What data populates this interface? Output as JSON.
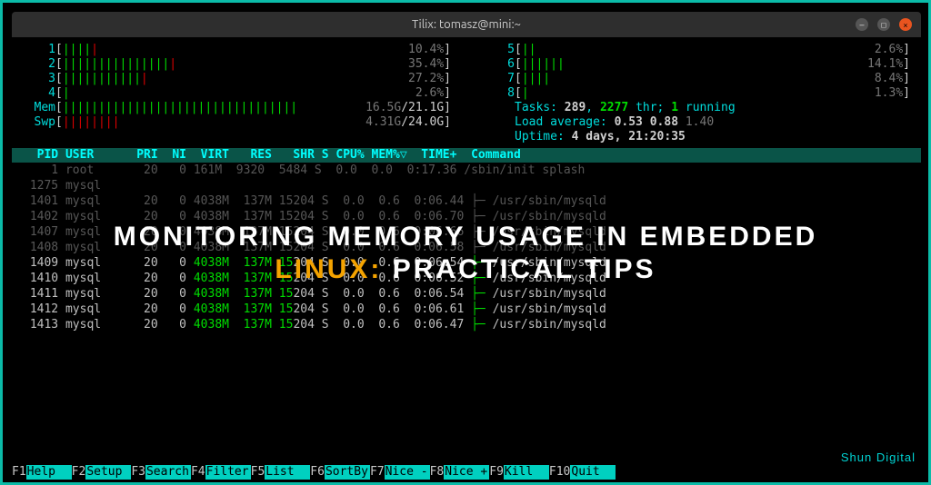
{
  "titlebar": {
    "title": "Tilix: tomasz@mini:~"
  },
  "overlay": {
    "line1": "MONITORING MEMORY USAGE IN EMBEDDED",
    "line2a": "LINUX:",
    "line2b": " PRACTICAL TIPS"
  },
  "brand": "Shun Digital",
  "cpus_left": [
    {
      "n": "1",
      "bars": "||||",
      "red": "|",
      "val": "10.4%"
    },
    {
      "n": "2",
      "bars": "|||||||||||||||",
      "red": "|",
      "val": "35.4%"
    },
    {
      "n": "3",
      "bars": "|||||||||||",
      "red": "|",
      "val": "27.2%"
    },
    {
      "n": "4",
      "bars": "|",
      "red": "",
      "val": "2.6%"
    }
  ],
  "cpus_right": [
    {
      "n": "5",
      "bars": "||",
      "red": "",
      "val": "2.6%"
    },
    {
      "n": "6",
      "bars": "||||||",
      "red": "",
      "val": "14.1%"
    },
    {
      "n": "7",
      "bars": "||||",
      "red": "",
      "val": "8.4%"
    },
    {
      "n": "8",
      "bars": "|",
      "red": "",
      "val": "1.3%"
    }
  ],
  "mem": {
    "label": "Mem",
    "green": "|||||||||||||||||||||||||||||||||",
    "used": "16.5G",
    "total": "21.1G"
  },
  "swp": {
    "label": "Swp",
    "red": "||||||||",
    "used": "4.31G",
    "total": "24.0G"
  },
  "sys": {
    "tasks_lbl": "Tasks: ",
    "tasks_n": "289",
    "thr_sep": ", ",
    "thr_n": "2277",
    "thr_lbl": " thr; ",
    "run_n": "1",
    "run_lbl": " running",
    "load_lbl": "Load average: ",
    "l1": "0.53",
    "l2": "0.88",
    "l3": "1.40",
    "uptime_lbl": "Uptime: ",
    "uptime": "4 days, 21:20:35"
  },
  "header": "  PID USER      PRI  NI  VIRT   RES   SHR S CPU% MEM%▽  TIME+  Command",
  "rows": [
    {
      "dim": true,
      "pre": "    1 root       20   0 ",
      "virt": "161M",
      "mid": "  9320  ",
      "shr": "5484",
      "post": " S  0.0  0.0  0:17.36 ",
      "cmd": "/sbin/init splash"
    },
    {
      "dim": true,
      "pre": " 1275 mysql",
      "virt": "",
      "mid": "",
      "shr": "",
      "post": "",
      "cmd": ""
    },
    {
      "dim": true,
      "pre": " 1401 mysql      20   0 ",
      "virt": "4038M",
      "mid": "  ",
      "res": "137M",
      "mid2": " ",
      "shr": "15204",
      "post": " S  0.0  0.6  0:06.44 ",
      "tree": "├─ ",
      "cmd": "/usr/sbin/mysqld"
    },
    {
      "dim": true,
      "pre": " 1402 mysql      20   0 ",
      "virt": "4038M",
      "mid": "  ",
      "res": "137M",
      "mid2": " ",
      "shr": "15204",
      "post": " S  0.0  0.6  0:06.70 ",
      "tree": "├─ ",
      "cmd": "/usr/sbin/mysqld"
    },
    {
      "dim": true,
      "pre": " 1407 mysql      20   0 ",
      "virt": "4038M",
      "mid": "  ",
      "res": "137M",
      "mid2": " ",
      "shr": "15204",
      "post": " S  0.0  0.6  0:06.66 ",
      "tree": "├─ ",
      "cmd": "/usr/sbin/mysqld"
    },
    {
      "dim": true,
      "pre": " 1408 mysql      20   0 ",
      "virt": "4038M",
      "mid": "  ",
      "res": "137M",
      "mid2": " ",
      "shr": "15204",
      "post": " S  0.0  0.6  0:06.58 ",
      "tree": "├─ ",
      "cmd": "/usr/sbin/mysqld"
    },
    {
      "dim": false,
      "pre": " 1409 mysql      20   0 ",
      "virt": "4038M",
      "mid": "  ",
      "res": "137M",
      "mid2": " ",
      "shr": "15204",
      "post": " S  0.0  0.6  0:06.54 ",
      "tree": "├─ ",
      "cmd": "/usr/sbin/mysqld"
    },
    {
      "dim": false,
      "pre": " 1410 mysql      20   0 ",
      "virt": "4038M",
      "mid": "  ",
      "res": "137M",
      "mid2": " ",
      "shr": "15204",
      "post": " S  0.0  0.6  0:06.52 ",
      "tree": "├─ ",
      "cmd": "/usr/sbin/mysqld"
    },
    {
      "dim": false,
      "pre": " 1411 mysql      20   0 ",
      "virt": "4038M",
      "mid": "  ",
      "res": "137M",
      "mid2": " ",
      "shr": "15204",
      "post": " S  0.0  0.6  0:06.54 ",
      "tree": "├─ ",
      "cmd": "/usr/sbin/mysqld"
    },
    {
      "dim": false,
      "pre": " 1412 mysql      20   0 ",
      "virt": "4038M",
      "mid": "  ",
      "res": "137M",
      "mid2": " ",
      "shr": "15204",
      "post": " S  0.0  0.6  0:06.61 ",
      "tree": "├─ ",
      "cmd": "/usr/sbin/mysqld"
    },
    {
      "dim": false,
      "pre": " 1413 mysql      20   0 ",
      "virt": "4038M",
      "mid": "  ",
      "res": "137M",
      "mid2": " ",
      "shr": "15204",
      "post": " S  0.0  0.6  0:06.47 ",
      "tree": "├─ ",
      "cmd": "/usr/sbin/mysqld"
    }
  ],
  "fkeys": [
    {
      "k": "F1",
      "l": "Help  "
    },
    {
      "k": "F2",
      "l": "Setup "
    },
    {
      "k": "F3",
      "l": "Search"
    },
    {
      "k": "F4",
      "l": "Filter"
    },
    {
      "k": "F5",
      "l": "List  "
    },
    {
      "k": "F6",
      "l": "SortBy"
    },
    {
      "k": "F7",
      "l": "Nice -"
    },
    {
      "k": "F8",
      "l": "Nice +"
    },
    {
      "k": "F9",
      "l": "Kill  "
    },
    {
      "k": "F10",
      "l": "Quit  "
    }
  ]
}
